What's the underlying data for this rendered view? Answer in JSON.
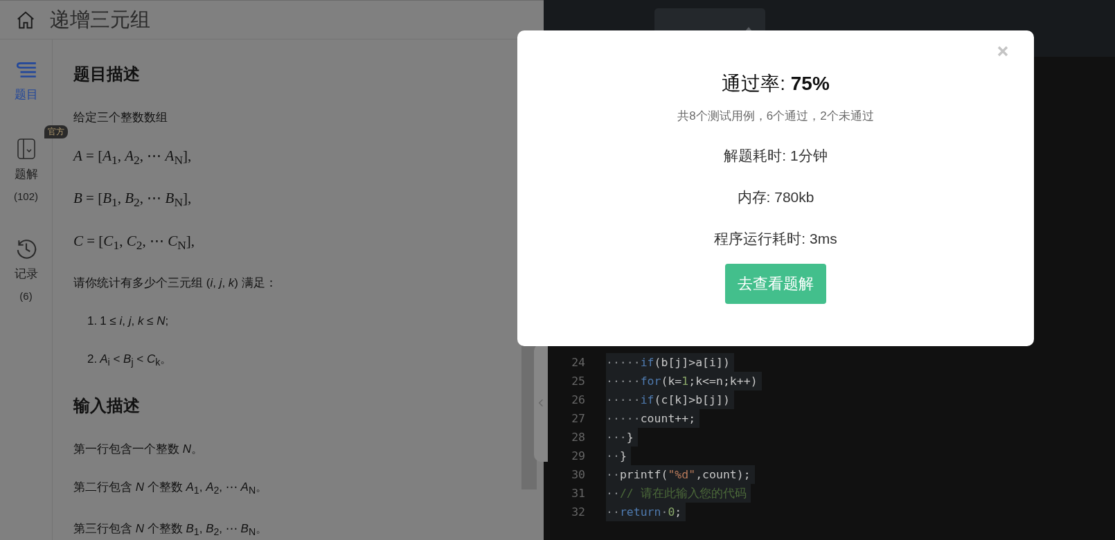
{
  "header": {
    "title": "递增三元组"
  },
  "sidebar": {
    "items": [
      {
        "label": "题目",
        "selected": true
      },
      {
        "label": "题解",
        "count": "(102)",
        "badge": "官方",
        "selected": false
      },
      {
        "label": "记录",
        "count": "(6)",
        "selected": false
      }
    ]
  },
  "problem": [
    {
      "kind": "heading",
      "text": "题目描述"
    },
    {
      "kind": "paragraph",
      "text": "给定三个整数数组"
    },
    {
      "kind": "formula",
      "text": "*A* = [*A*$_{1}$, *A*$_{2}$, ⋯ *A*$_{N}$],"
    },
    {
      "kind": "formula",
      "text": "*B* = [*B*$_{1}$, *B*$_{2}$, ⋯ *B*$_{N}$],"
    },
    {
      "kind": "formula",
      "text": "*C* = [*C*$_{1}$, *C*$_{2}$, ⋯ *C*$_{N}$],"
    },
    {
      "kind": "paragraph",
      "text": "请你统计有多少个三元组 (*i*, *j*, *k*) 满足："
    },
    {
      "kind": "list_item",
      "marker": "1.",
      "text": "1 ≤ *i*, *j*, *k* ≤ *N*;"
    },
    {
      "kind": "list_item",
      "marker": "2.",
      "text": "*A*$_{i}$ < *B*$_{j}$ < *C*$_{k}$。"
    },
    {
      "kind": "heading",
      "text": "输入描述"
    },
    {
      "kind": "paragraph",
      "text": "第一行包含一个整数 *N*。"
    },
    {
      "kind": "paragraph",
      "text": "第二行包含 *N* 个整数 *A*$_{1}$, *A*$_{2}$, ⋯ *A*$_{N}$。"
    },
    {
      "kind": "paragraph",
      "text": "第三行包含 *N* 个整数 *B*$_{1}$, *B*$_{2}$, ⋯ *B*$_{N}$。"
    }
  ],
  "editor": {
    "lines": [
      {
        "number": "24",
        "tokens": [
          {
            "kind": "ws",
            "text": "·····"
          },
          {
            "kind": "keyword",
            "text": "if"
          },
          {
            "kind": "plain",
            "text": "(b[j]>a[i])"
          }
        ]
      },
      {
        "number": "25",
        "tokens": [
          {
            "kind": "ws",
            "text": "·····"
          },
          {
            "kind": "keyword",
            "text": "for"
          },
          {
            "kind": "plain",
            "text": "(k="
          },
          {
            "kind": "number",
            "text": "1"
          },
          {
            "kind": "plain",
            "text": ";k<=n;k++)"
          }
        ]
      },
      {
        "number": "26",
        "tokens": [
          {
            "kind": "ws",
            "text": "·····"
          },
          {
            "kind": "keyword",
            "text": "if"
          },
          {
            "kind": "plain",
            "text": "(c[k]>b[j])"
          }
        ]
      },
      {
        "number": "27",
        "tokens": [
          {
            "kind": "ws",
            "text": "·····"
          },
          {
            "kind": "plain",
            "text": "count++;"
          }
        ]
      },
      {
        "number": "28",
        "tokens": [
          {
            "kind": "ws",
            "text": "···"
          },
          {
            "kind": "plain",
            "text": "}"
          }
        ]
      },
      {
        "number": "29",
        "tokens": [
          {
            "kind": "ws",
            "text": "··"
          },
          {
            "kind": "plain",
            "text": "}"
          }
        ]
      },
      {
        "number": "30",
        "tokens": [
          {
            "kind": "ws",
            "text": "··"
          },
          {
            "kind": "plain",
            "text": "printf("
          },
          {
            "kind": "string",
            "text": "\"%d\""
          },
          {
            "kind": "plain",
            "text": ",count);"
          }
        ]
      },
      {
        "number": "31",
        "tokens": [
          {
            "kind": "ws",
            "text": "··"
          },
          {
            "kind": "comment",
            "text": "// 请在此输入您的代码"
          }
        ]
      },
      {
        "number": "32",
        "tokens": [
          {
            "kind": "ws",
            "text": "··"
          },
          {
            "kind": "keyword",
            "text": "return"
          },
          {
            "kind": "ws",
            "text": "·"
          },
          {
            "kind": "number",
            "text": "0"
          },
          {
            "kind": "plain",
            "text": ";"
          }
        ]
      }
    ]
  },
  "result_dialog": {
    "title": "通过率: **75%**",
    "summary": "共8个测试用例，6个通过，2个未通过",
    "stats": [
      "解题耗时: 1分钟",
      "内存: 780kb",
      "程序运行耗时: 3ms"
    ],
    "button": "去查看题解"
  }
}
